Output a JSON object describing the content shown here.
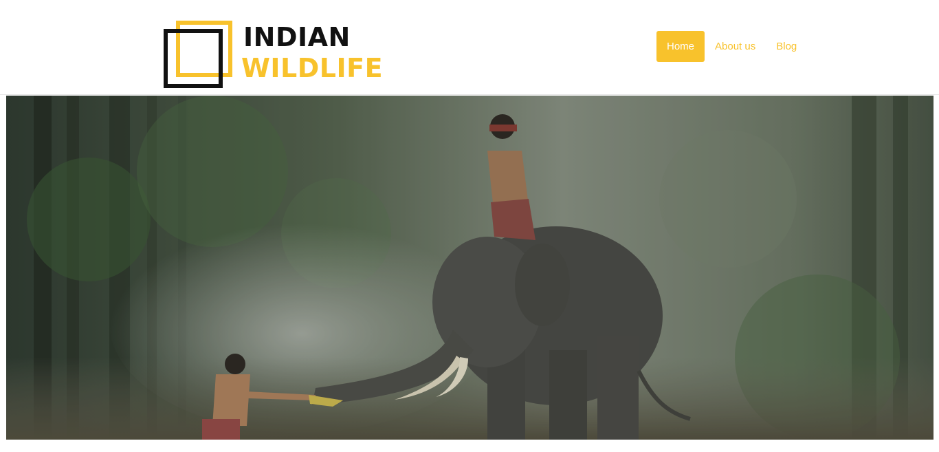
{
  "logo": {
    "line1": "INDIAN",
    "line2": "WILDLIFE",
    "mark_icon": "double-square-logo-icon"
  },
  "nav": {
    "items": [
      {
        "label": "Home",
        "active": true
      },
      {
        "label": "About us",
        "active": false
      },
      {
        "label": "Blog",
        "active": false
      }
    ]
  },
  "hero": {
    "image_subject": "hero-photo-elephant-forest"
  },
  "colors": {
    "accent": "#f8c22c",
    "logo_dark": "#111111",
    "header_bg": "#ffffff"
  }
}
